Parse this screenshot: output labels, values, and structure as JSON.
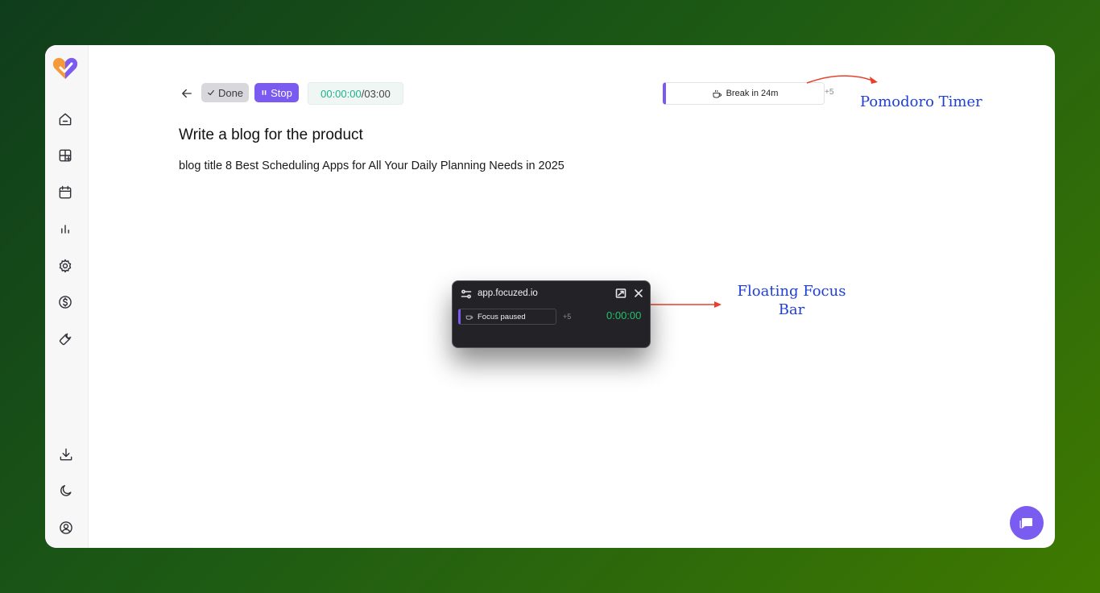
{
  "toolbar": {
    "done_label": "Done",
    "stop_label": "Stop",
    "timer_elapsed": "00:00:00",
    "timer_separator": "/",
    "timer_total": "03:00"
  },
  "task": {
    "title": "Write a blog for the product",
    "description": "blog title 8 Best Scheduling Apps for All Your Daily Planning Needs in 2025"
  },
  "pomodoro": {
    "label": "Break in 24m",
    "extra": "+5"
  },
  "annotations": {
    "pomodoro": "Pomodoro Timer",
    "floating_line1": "Floating Focus",
    "floating_line2": "Bar"
  },
  "floating_bar": {
    "title": "app.focuzed.io",
    "status": "Focus paused",
    "extra": "+5",
    "timer": "0:00:00"
  },
  "colors": {
    "accent": "#7a5af0",
    "timer_green": "#23c06b",
    "annotation_blue": "#1f3fd6",
    "arrow_red": "#e8402a"
  },
  "sidebar": {
    "icons": [
      "home-icon",
      "add-widget-icon",
      "calendar-icon",
      "bar-chart-icon",
      "settings-icon",
      "dollar-icon",
      "wrench-icon",
      "download-icon",
      "moon-icon",
      "user-circle-icon"
    ]
  }
}
